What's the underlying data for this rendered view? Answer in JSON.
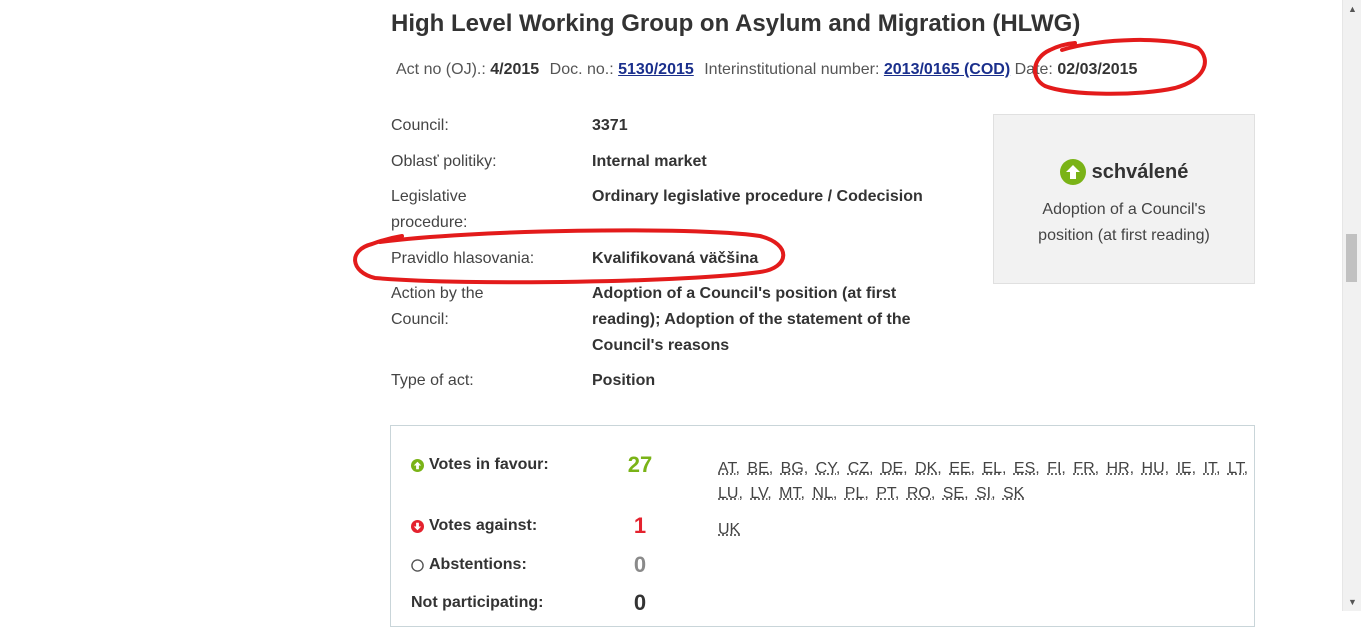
{
  "title": "High Level Working Group on Asylum and Migration (HLWG)",
  "meta": {
    "act_label": "Act no (OJ).:",
    "act_value": "4/2015",
    "doc_label": "Doc. no.:",
    "doc_value": "5130/2015",
    "inter_label": "Interinstitutional number:",
    "inter_value": "2013/0165 (COD)",
    "date_label": "Date:",
    "date_value": "02/03/2015"
  },
  "details": [
    {
      "label": "Council:",
      "value": "3371"
    },
    {
      "label": "Oblasť politiky:",
      "value": "Internal market"
    },
    {
      "label": "Legislative procedure:",
      "value": "Ordinary legislative procedure / Codecision"
    },
    {
      "label": "Pravidlo hlasovania:",
      "value": "Kvalifikovaná väčšina"
    },
    {
      "label": "Action by the Council:",
      "value": "Adoption of a Council's position (at first reading); Adoption of the statement of the Council's reasons"
    },
    {
      "label": "Type of act:",
      "value": "Position"
    }
  ],
  "status": {
    "title": "schválené",
    "description": "Adoption of a Council's position (at first reading)",
    "icon": "arrow-up-circle-icon",
    "color": "#7ab317"
  },
  "votes": {
    "favour": {
      "label": "Votes in favour:",
      "count": "27",
      "color": "#7ab317",
      "countries": [
        "AT,",
        "BE,",
        "BG,",
        "CY,",
        "CZ,",
        "DE,",
        "DK,",
        "EE,",
        "EL,",
        "ES,",
        "FI,",
        "FR,",
        "HR,",
        "HU,",
        "IE,",
        "IT,",
        "LT,",
        "LU,",
        "LV,",
        "MT,",
        "NL,",
        "PL,",
        "PT,",
        "RO,",
        "SE,",
        "SI,",
        "SK"
      ]
    },
    "against": {
      "label": "Votes against:",
      "count": "1",
      "color": "#e4222e",
      "countries": [
        "UK"
      ]
    },
    "abstentions": {
      "label": "Abstentions:",
      "count": "0",
      "color": "#8a8a8a"
    },
    "not_participating": {
      "label": "Not participating:",
      "count": "0",
      "color": "#333333"
    }
  }
}
